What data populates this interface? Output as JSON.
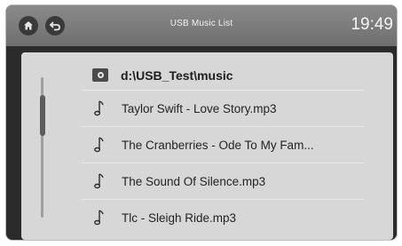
{
  "header": {
    "title": "USB Music List",
    "clock": "19:49",
    "home_icon": "home-icon",
    "back_icon": "back-icon"
  },
  "browser": {
    "path": "d:\\USB_Test\\music",
    "folder_icon": "folder-icon",
    "songs": [
      {
        "label": "Taylor Swift - Love Story.mp3"
      },
      {
        "label": "The Cranberries - Ode To My Fam..."
      },
      {
        "label": "The Sound Of Silence.mp3"
      },
      {
        "label": "Tlc - Sleigh Ride.mp3"
      }
    ]
  },
  "colors": {
    "topbar": "#7d7d7d",
    "panel": "#d7d7d7",
    "text": "#232323"
  }
}
